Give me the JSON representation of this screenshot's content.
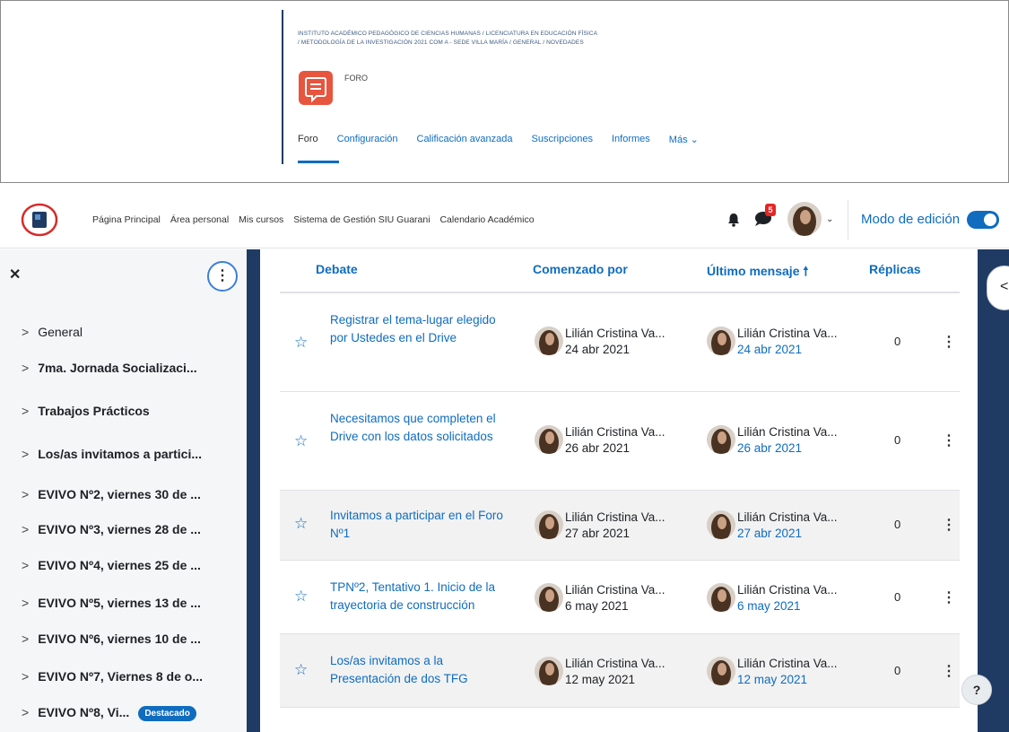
{
  "top": {
    "breadcrumb_line1": "INSTITUTO ACADÉMICO PEDAGÓGICO DE CIENCIAS HUMANAS  /  LICENCIATURA EN EDUCACIÓN FÍSICA",
    "breadcrumb_line2": "/  METODOLOGÍA DE LA INVESTIGACIÓN 2021 COM A - SEDE VILLA MARÍA  /  GENERAL  /  NOVEDADES",
    "activity_type": "FORO",
    "tabs": [
      "Foro",
      "Configuración",
      "Calificación avanzada",
      "Suscripciones",
      "Informes",
      "Más ⌄"
    ]
  },
  "navbar": {
    "links": [
      "Página Principal",
      "Área personal",
      "Mis cursos",
      "Sistema de Gestión SIU Guarani",
      "Calendario Académico"
    ],
    "message_badge": "5",
    "edit_mode_label": "Modo de edición",
    "edit_mode_on": true
  },
  "drawer": {
    "sections": [
      "General",
      "7ma. Jornada Socializaci...",
      "Trabajos Prácticos",
      "Los/as invitamos a partici...",
      "EVIVO Nº2, viernes 30 de ...",
      "EVIVO Nº3, viernes 28 de ...",
      "EVIVO Nº4, viernes 25 de ...",
      "EVIVO Nº5, viernes 13 de ...",
      "EVIVO Nº6, viernes 10 de ...",
      "EVIVO Nº7, Viernes 8 de o...",
      "EVIVO Nº8, Vi..."
    ],
    "featured_badge": "Destacado"
  },
  "table": {
    "headers": {
      "debate": "Debate",
      "started_by": "Comenzado por",
      "last_post": "Último mensaje",
      "replies": "Réplicas"
    },
    "rows": [
      {
        "topic": "Registrar el tema-lugar elegido por Ustedes en el Drive",
        "author": "Lilián Cristina Va...",
        "started": "24 abr 2021",
        "last_author": "Lilián Cristina Va...",
        "last_date": "24 abr 2021",
        "replies": "0"
      },
      {
        "topic": "Necesitamos que completen el Drive con los datos solicitados",
        "author": "Lilián Cristina Va...",
        "started": "26 abr 2021",
        "last_author": "Lilián Cristina Va...",
        "last_date": "26 abr 2021",
        "replies": "0"
      },
      {
        "topic": "Invitamos a participar en el Foro Nº1",
        "author": "Lilián Cristina Va...",
        "started": "27 abr 2021",
        "last_author": "Lilián Cristina Va...",
        "last_date": "27 abr 2021",
        "replies": "0"
      },
      {
        "topic": "TPNº2, Tentativo 1. Inicio de la trayectoria de construcción",
        "author": "Lilián Cristina Va...",
        "started": "6 may 2021",
        "last_author": "Lilián Cristina Va...",
        "last_date": "6 may 2021",
        "replies": "0"
      },
      {
        "topic": "Los/as invitamos a la Presentación de dos TFG",
        "author": "Lilián Cristina Va...",
        "started": "12 may 2021",
        "last_author": "Lilián Cristina Va...",
        "last_date": "12 may 2021",
        "replies": "0"
      }
    ]
  },
  "help": "?",
  "colors": {
    "accent": "#0f6cbf",
    "navy": "#1f3b63",
    "forum_icon": "#e8553e",
    "badge_red": "#e42626"
  }
}
